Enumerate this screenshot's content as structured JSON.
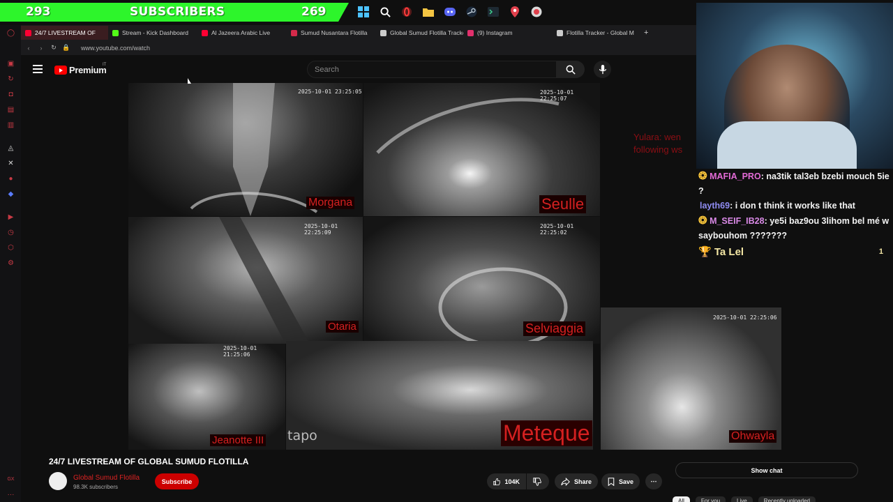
{
  "overlay": {
    "sub_left": "293",
    "sub_label": "SUBSCRIBERS",
    "sub_right": "269"
  },
  "taskbar_icons": [
    "windows-icon",
    "search-icon",
    "opera-icon",
    "folder-icon",
    "discord-icon",
    "steam-icon",
    "terminal-icon",
    "location-icon",
    "app-icon"
  ],
  "browser": {
    "tabs": [
      {
        "label": "24/7 LIVESTREAM OF",
        "color": "#ff0033",
        "active": true
      },
      {
        "label": "Stream - Kick Dashboard",
        "color": "#53fc18",
        "active": false
      },
      {
        "label": "Al Jazeera Arabic Live",
        "color": "#ff0033",
        "active": false
      },
      {
        "label": "Sumud Nusantara Flotilla",
        "color": "#d42a4a",
        "active": false
      },
      {
        "label": "Global Sumud Flotilla Tracker",
        "color": "#cccccc",
        "active": false
      },
      {
        "label": "(9) Instagram",
        "color": "#e1306c",
        "active": false
      },
      {
        "label": "Flotilla Tracker - Global M",
        "color": "#cccccc",
        "active": false
      }
    ],
    "url": "www.youtube.com/watch",
    "new_tab": "+"
  },
  "youtube": {
    "logo": "Premium",
    "country_code": "IT",
    "search_placeholder": "Search"
  },
  "cameras": [
    {
      "name": "Morgana",
      "timestamp": "2025-10-01 23:25:05"
    },
    {
      "name": "Seulle",
      "timestamp": "2025-10-01 22:25:07"
    },
    {
      "name": "Otaria",
      "timestamp": "2025-10-01 22:25:09"
    },
    {
      "name": "Selviaggia",
      "timestamp": "2025-10-01 22:25:02"
    },
    {
      "name": "Jeanotte III",
      "timestamp": "2025-10-01 21:25:06"
    },
    {
      "name": "Meteque",
      "timestamp": ""
    },
    {
      "name": "Ohwayla",
      "timestamp": "2025-10-01 22:25:06"
    }
  ],
  "watermark": "tapo",
  "overlay_text": "Yulara: wen\nfollowing ws",
  "chat": [
    {
      "user": "MAFIA_PRO",
      "text": ": na3tik tal3eb bzebi mouch 5ie ?",
      "user_class": "u1",
      "badge": "❂"
    },
    {
      "user": "layth69",
      "text": ": i don t think it works like that",
      "user_class": "u2",
      "badge": ""
    },
    {
      "user": "M_SEIF_IB28",
      "text": ": ye5i baz9ou 3lihom bel mé w saybouhom ???????",
      "user_class": "u3",
      "badge": "❂"
    },
    {
      "user": "Ta Lel",
      "text": "",
      "user_class": "gift",
      "badge": "🏆",
      "count": "1"
    }
  ],
  "video": {
    "title": "24/7 LIVESTREAM OF GLOBAL SUMUD FLOTILLA",
    "channel": "Global Sumud Flotilla",
    "subscribers": "98.3K subscribers",
    "subscribe_label": "Subscribe",
    "likes": "104K",
    "share_label": "Share",
    "save_label": "Save",
    "show_chat_label": "Show chat"
  },
  "chips": [
    "All",
    "For you",
    "Live",
    "Recently uploaded"
  ]
}
